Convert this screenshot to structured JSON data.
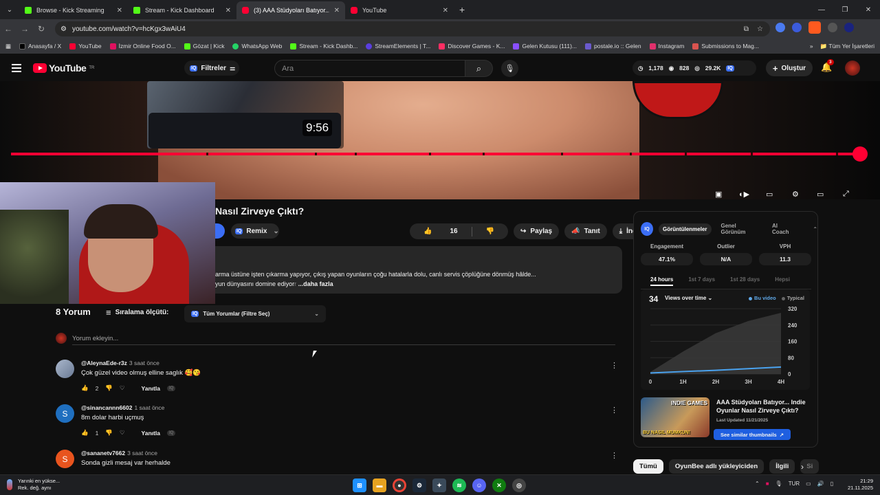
{
  "browser": {
    "tabs": [
      {
        "title": "Browse - Kick Streaming",
        "color": "#53fc18",
        "active": false
      },
      {
        "title": "Stream - Kick Dashboard",
        "color": "#53fc18",
        "active": false
      },
      {
        "title": "(3) AAA Stüdyoları Batıyor... Ind",
        "color": "#ff0033",
        "active": true
      },
      {
        "title": "YouTube",
        "color": "#ff0033",
        "active": false
      }
    ],
    "url": "youtube.com/watch?v=hcKgx3wAiU4",
    "bookmarks": [
      {
        "label": "Anasayfa / X",
        "color": "#000000"
      },
      {
        "label": "YouTube",
        "color": "#ff0033"
      },
      {
        "label": "İzmir Online Food O...",
        "color": "#e0115f"
      },
      {
        "label": "Gözat | Kick",
        "color": "#53fc18"
      },
      {
        "label": "WhatsApp Web",
        "color": "#25d366"
      },
      {
        "label": "Stream - Kick Dashb...",
        "color": "#53fc18"
      },
      {
        "label": "StreamElements | T...",
        "color": "#5a3ee0"
      },
      {
        "label": "Discover Games - K...",
        "color": "#ff2e63"
      },
      {
        "label": "Gelen Kutusu (111)...",
        "color": "#8a4fff"
      },
      {
        "label": "postale.io :: Gelen",
        "color": "#6a5acd"
      },
      {
        "label": "Instagram",
        "color": "#e1306c"
      },
      {
        "label": "Submissions to Mag...",
        "color": "#d9534f"
      }
    ],
    "all_bookmarks": "Tüm Yer İşaretleri"
  },
  "youtube": {
    "logo_suffix": "TR",
    "filters_label": "Filtreler",
    "search_placeholder": "Ara",
    "stats": {
      "s1": "1,178",
      "s2": "828",
      "s3": "29.2K"
    },
    "create_label": "Oluştur",
    "notif_count": "3"
  },
  "video": {
    "preview_time": "9:56",
    "title": "Nasıl Zirveye Çıktı?",
    "remix_label": "Remix",
    "likes": "16",
    "share_label": "Paylaş",
    "promote_label": "Tanıt",
    "download_label": "İndir",
    "desc_line1": "arma üstüne işten çıkarma yapıyor, çıkış yapan oyunların çoğu hatalarla dolu, canlı servis çöplüğüne dönmüş hâlde...",
    "desc_line2": "yun dünyasını domine ediyor",
    "desc_more": "...daha fazla"
  },
  "comments": {
    "count_label": "8 Yorum",
    "sort_label": "Sıralama ölçütü:",
    "filter_label": "Tüm Yorumlar (Filtre Seç)",
    "add_placeholder": "Yorum ekleyin...",
    "reply_label": "Yanıtla",
    "items": [
      {
        "author": "@AleynaEde-r3z",
        "time": "3 saat önce",
        "text": "Çok güzel video olmuş elline saglık 🥰😘",
        "likes": "2",
        "avatar_letter": "",
        "avatar_color": "#8a9bb5"
      },
      {
        "author": "@sinancannn6602",
        "time": "1 saat önce",
        "text": "8m dolar harbi uçmuş",
        "likes": "1",
        "avatar_letter": "S",
        "avatar_color": "#1f6fbf"
      },
      {
        "author": "@sananetv7662",
        "time": "3 saat önce",
        "text": "Sonda gizli mesaj var herhalde",
        "likes": "",
        "avatar_letter": "S",
        "avatar_color": "#e8541e"
      }
    ]
  },
  "panel": {
    "tabs": [
      "Görüntülenmeler",
      "Genel Görünüm",
      "AI Coach"
    ],
    "metrics": [
      {
        "label": "Engagement",
        "value": "47.1%"
      },
      {
        "label": "Outlier",
        "value": "N/A"
      },
      {
        "label": "VPH",
        "value": "11.3"
      }
    ],
    "ranges": [
      "24 hours",
      "1st 7 days",
      "1st 28 days",
      "Hepsi"
    ],
    "chart_count": "34",
    "chart_mode": "Views over time",
    "legend_this": "Bu video",
    "legend_typical": "Typical",
    "thumb_title": "AAA Stüdyoları Batıyor... Indie Oyunlar Nasıl Zirveye Çıktı?",
    "thumb_updated": "Last Updated 11/21/2025",
    "thumb_button": "See similar thumbnails",
    "thumb_text_bottom": "BU NASIL MUMKUN!",
    "thumb_text_top": "INDIE GAMES"
  },
  "chart_data": {
    "type": "area",
    "x": [
      "0",
      "1H",
      "2H",
      "3H",
      "4H"
    ],
    "yticks": [
      0,
      80,
      160,
      240,
      320
    ],
    "ylim": [
      0,
      320
    ],
    "series": [
      {
        "name": "Bu video",
        "values": [
          5,
          12,
          18,
          26,
          34
        ]
      },
      {
        "name": "Typical",
        "values": [
          10,
          110,
          200,
          260,
          300
        ]
      }
    ],
    "grid": true
  },
  "chips": [
    "Tümü",
    "OyunBee adlı yükleyiciden",
    "İlgili",
    "Si"
  ],
  "taskbar": {
    "weather_line1": "Yarınki en yükse...",
    "weather_line2": "Rek. değ. aynı",
    "lang": "TUR",
    "time": "21:29",
    "date": "21.11.2025"
  }
}
